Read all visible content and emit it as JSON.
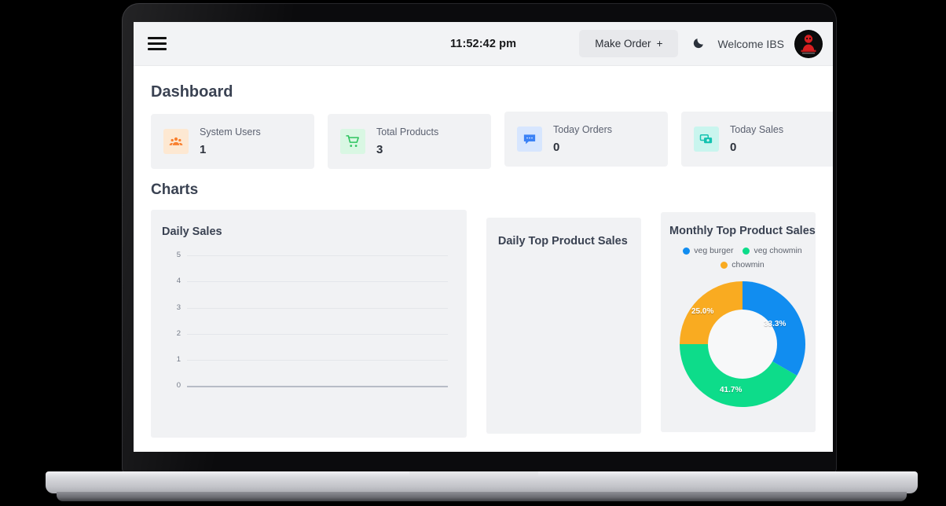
{
  "topbar": {
    "menu_icon": "hamburger-menu-icon",
    "clock": "11:52:42 pm",
    "make_order_label": "Make Order",
    "make_order_plus": "+",
    "theme_toggle_icon": "moon-icon",
    "welcome_text": "Welcome IBS",
    "avatar_alt": "user-avatar-logo"
  },
  "page": {
    "title": "Dashboard",
    "charts_heading": "Charts"
  },
  "stats": [
    {
      "label": "System Users",
      "value": "1",
      "icon": "users-icon",
      "icon_color": "#f97f2e",
      "icon_bg": "#fde8d2"
    },
    {
      "label": "Total Products",
      "value": "3",
      "icon": "shopping-cart-icon",
      "icon_color": "#2ec45f",
      "icon_bg": "#d9f7e3"
    },
    {
      "label": "Today Orders",
      "value": "0",
      "icon": "chat-bubble-icon",
      "icon_color": "#3b82f6",
      "icon_bg": "#d7e6fe"
    },
    {
      "label": "Today Sales",
      "value": "0",
      "icon": "cash-money-icon",
      "icon_color": "#12c2b0",
      "icon_bg": "#c9f5ee"
    }
  ],
  "panels": {
    "daily_sales_title": "Daily Sales",
    "daily_top_title": "Daily Top Product Sales",
    "monthly_title": "Monthly Top Product Sales"
  },
  "chart_data": [
    {
      "type": "line",
      "title": "Daily Sales",
      "xlabel": "",
      "ylabel": "",
      "categories": [],
      "values": [],
      "ytick_labels": [
        "5",
        "4",
        "3",
        "2",
        "1",
        "0"
      ],
      "ylim": [
        0,
        5
      ],
      "grid": true,
      "legend": "none",
      "note": "no data series plotted"
    },
    {
      "type": "bar",
      "title": "Daily Top Product Sales",
      "categories": [],
      "values": [],
      "grid": false,
      "legend": "none",
      "note": "panel empty, no data rendered"
    },
    {
      "type": "pie",
      "title": "Monthly Top Product Sales",
      "labels": [
        "veg burger",
        "veg chowmin",
        "chowmin"
      ],
      "values": [
        33.3,
        41.7,
        25.0
      ],
      "value_labels": [
        "33.3%",
        "41.7%",
        "25.0%"
      ],
      "colors": [
        "#118df0",
        "#0ddc8a",
        "#f9ab21"
      ],
      "legend": "top",
      "donut": true,
      "hole_ratio": 0.52
    }
  ]
}
